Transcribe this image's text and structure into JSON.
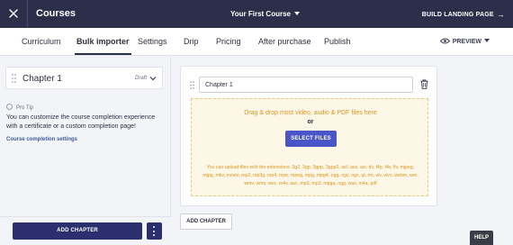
{
  "topbar": {
    "title": "Courses",
    "course_selector": "Your First Course",
    "build_landing": "BUILD LANDING PAGE"
  },
  "tabs": [
    {
      "label": "Curriculum"
    },
    {
      "label": "Bulk importer",
      "active": true
    },
    {
      "label": "Settings"
    },
    {
      "label": "Drip"
    },
    {
      "label": "Pricing"
    },
    {
      "label": "After purchase"
    },
    {
      "label": "Publish"
    }
  ],
  "preview": {
    "label": "PREVIEW"
  },
  "sidebar": {
    "chapter": {
      "name": "Chapter 1",
      "status": "Draft"
    },
    "protip": {
      "heading": "Pro Tip",
      "text": "You can customize the course completion experience with a certificate or a custom completion page!",
      "link": "Course completion settings"
    },
    "add_chapter": "ADD CHAPTER"
  },
  "main": {
    "chapter_input_value": "Chapter 1",
    "dropzone": {
      "line1": "Drag & drop most video, audio & PDF files here",
      "or": "or",
      "button": "SELECT FILES",
      "extensions": "You can upload files with the extensions: 3g2, 3gp, 3gpp, 3gpp2, asf, asx, avi, dv, f4p, f4v, flv, mjpeg, mjpg, mkv, movie, mp2, mp3g, mp4, mpe, mpeg, mpg, mpg4, ogg, ogv, ogx, qt, rm, viv, vivo, webm, wm, wmv, wmx, wvx, m4v, aac, mp3, mp3, mpga, ogg, wav, m4a, pdf"
    },
    "add_chapter": "ADD CHAPTER"
  },
  "help": "HELP",
  "colors": {
    "topbar": "#2b2f4a",
    "primary_button": "#2b2f6e",
    "select_files": "#4a55c9",
    "dropzone_bg": "#fdf7e7",
    "dropzone_text": "#d9961c"
  },
  "icons": {
    "close": "close-icon",
    "caret": "caret-down-icon",
    "arrow": "arrow-right-icon",
    "eye": "eye-icon",
    "drag": "drag-handle-icon",
    "chevron": "chevron-down-icon",
    "bulb": "lightbulb-icon",
    "trash": "trash-icon",
    "more": "more-vertical-icon"
  }
}
